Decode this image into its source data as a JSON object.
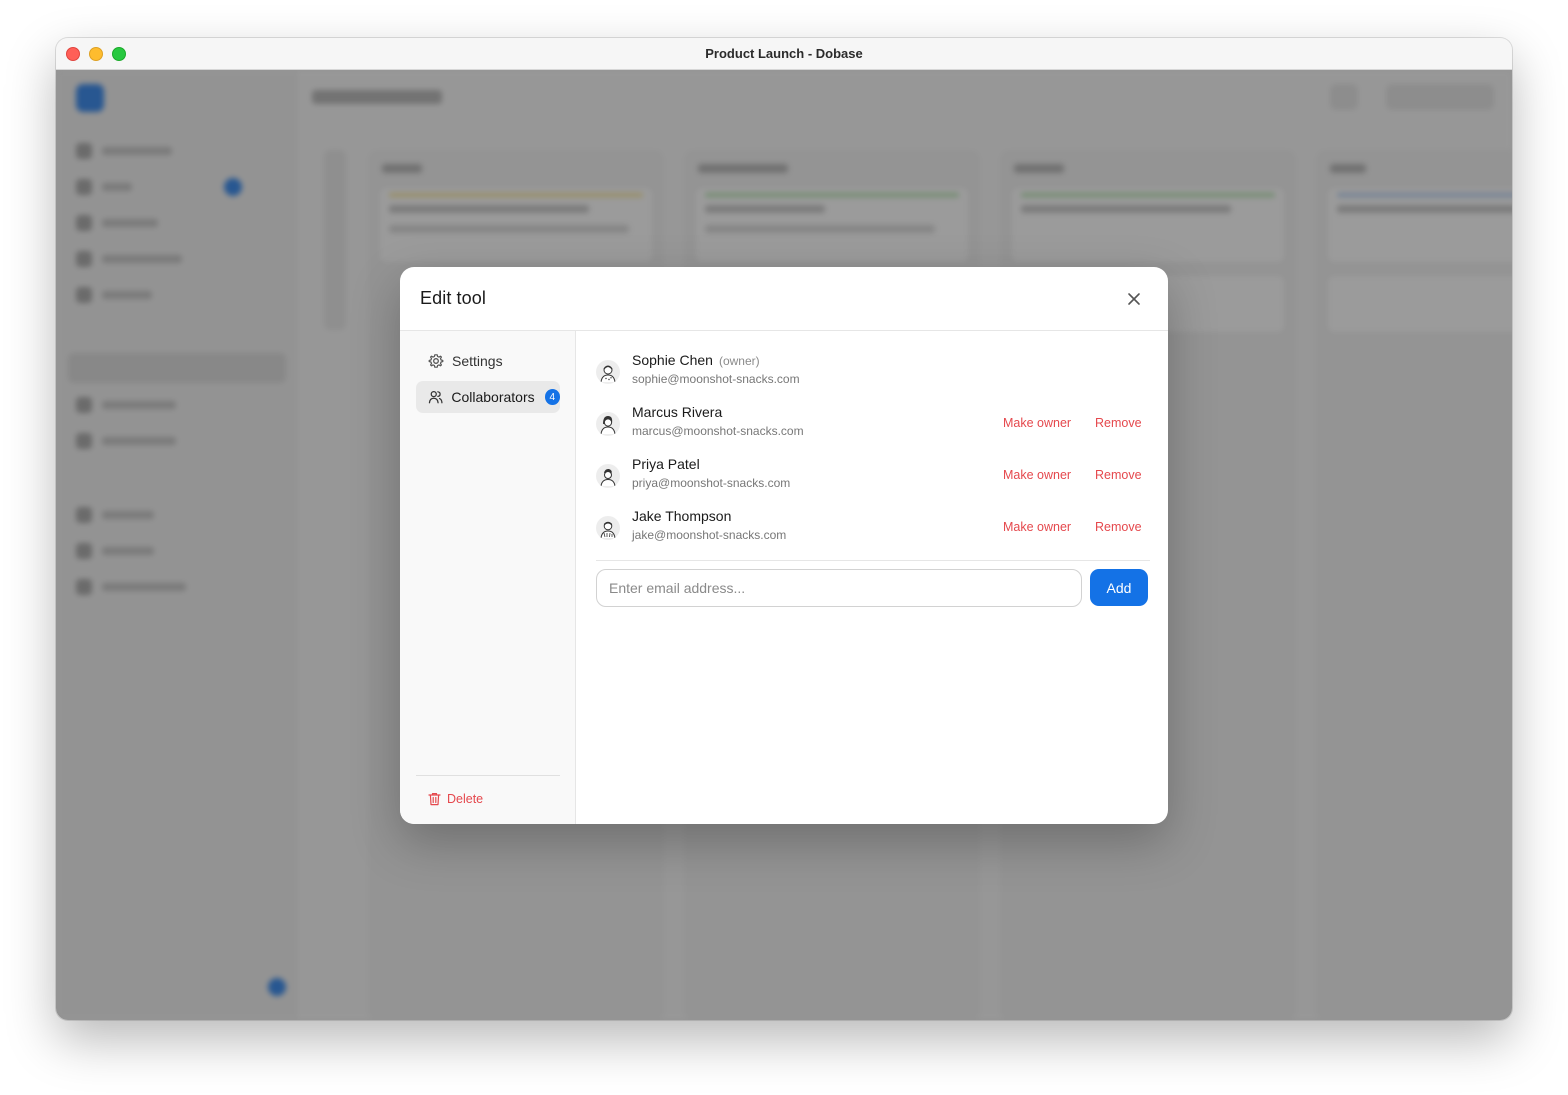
{
  "window": {
    "title": "Product Launch - Dobase"
  },
  "modal": {
    "title": "Edit tool",
    "nav": {
      "settings_label": "Settings",
      "collaborators_label": "Collaborators",
      "collaborators_count": "4",
      "delete_label": "Delete"
    },
    "collaborators": [
      {
        "name": "Sophie Chen",
        "role": "(owner)",
        "email": "sophie@moonshot-snacks.com",
        "is_owner": true
      },
      {
        "name": "Marcus Rivera",
        "email": "marcus@moonshot-snacks.com",
        "make_owner_label": "Make owner",
        "remove_label": "Remove"
      },
      {
        "name": "Priya Patel",
        "email": "priya@moonshot-snacks.com",
        "make_owner_label": "Make owner",
        "remove_label": "Remove"
      },
      {
        "name": "Jake Thompson",
        "email": "jake@moonshot-snacks.com",
        "make_owner_label": "Make owner",
        "remove_label": "Remove"
      }
    ],
    "add_form": {
      "placeholder": "Enter email address...",
      "add_label": "Add"
    }
  },
  "colors": {
    "accent": "#1472e6",
    "danger": "#e5484d"
  }
}
